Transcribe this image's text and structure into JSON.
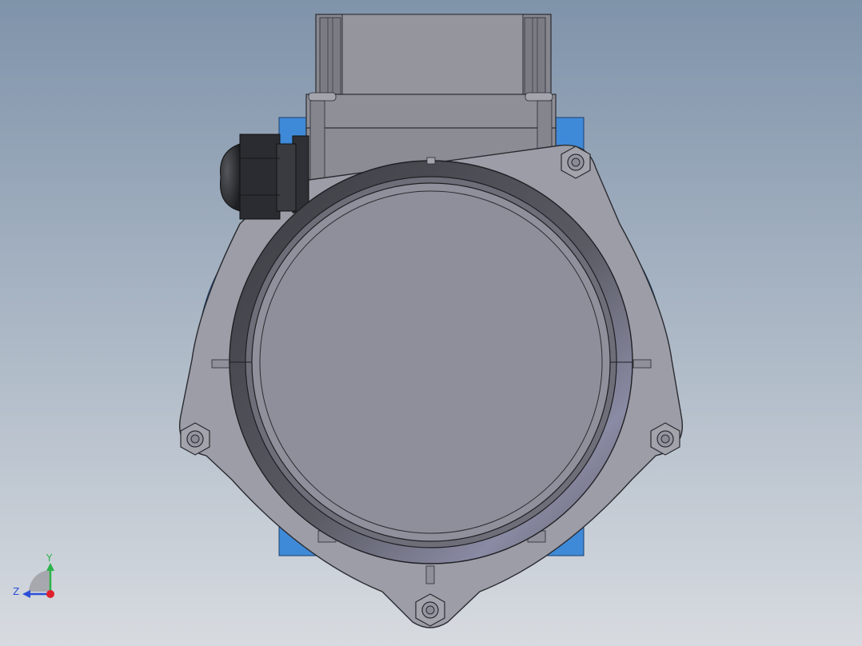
{
  "viewport": {
    "background_top": "#7f93aa",
    "background_bottom": "#d7dbe0"
  },
  "model": {
    "body_color": "#8f909c",
    "flange_color": "#9d9ea8",
    "ring_color": "#4a4b52",
    "accent_blue": "#3f8ad8",
    "cable_gland_color": "#2f3035"
  },
  "triad": {
    "y_label": "Y",
    "z_label": "Z",
    "y_color": "#2db34a",
    "z_color": "#2c4fd6",
    "x_color": "#e0202a"
  }
}
